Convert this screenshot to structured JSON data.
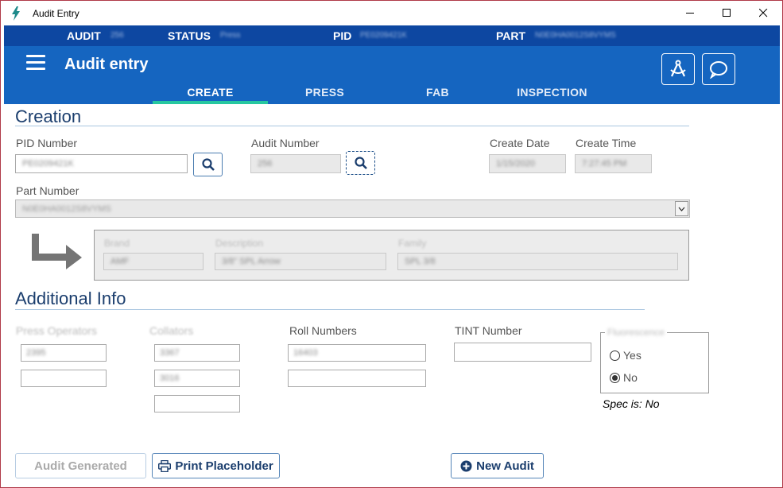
{
  "window": {
    "title": "Audit Entry"
  },
  "infobar": {
    "audit_label": "AUDIT",
    "audit_value": "256",
    "status_label": "STATUS",
    "status_value": "Press",
    "pid_label": "PID",
    "pid_value": "PE0209421K",
    "part_label": "PART",
    "part_value": "N0E0HA0012S8VYMS"
  },
  "header": {
    "title": "Audit entry",
    "tabs": [
      {
        "label": "CREATE",
        "active": true
      },
      {
        "label": "PRESS",
        "active": false
      },
      {
        "label": "FAB",
        "active": false
      },
      {
        "label": "INSPECTION",
        "active": false
      }
    ]
  },
  "creation": {
    "section_title": "Creation",
    "pid_label": "PID Number",
    "pid_value": "PE0209421K",
    "audit_label": "Audit Number",
    "audit_value": "256",
    "create_date_label": "Create Date",
    "create_date_value": "1/15/2020",
    "create_time_label": "Create Time",
    "create_time_value": "7:27:45 PM",
    "part_label": "Part Number",
    "part_value": "N0E0HA0012S8VYMS"
  },
  "details": {
    "brand_label": "Brand",
    "brand_value": "AMF",
    "description_label": "Description",
    "description_value": "3/8\" SPL Arrow",
    "family_label": "Family",
    "family_value": "SPL 3/8"
  },
  "additional": {
    "section_title": "Additional Info",
    "press_operators_label": "Press Operators",
    "press_operators": [
      "2395",
      ""
    ],
    "collators_label": "Collators",
    "collators": [
      "3367",
      "3016",
      ""
    ],
    "roll_numbers_label": "Roll Numbers",
    "roll_numbers": [
      "16403",
      ""
    ],
    "tint_number_label": "TINT Number",
    "tint_number": "",
    "fluorescence_label": "Fluorescence",
    "yes_label": "Yes",
    "no_label": "No",
    "selected": "No",
    "spec_text": "Spec is: No"
  },
  "buttons": {
    "audit_generated": "Audit Generated",
    "print_placeholder": "Print Placeholder",
    "new_audit": "New Audit"
  },
  "colors": {
    "header_blue": "#1565c0",
    "infobar_blue": "#0d47a1",
    "tab_underline": "#26c7a0",
    "title_text": "#1a3d6d"
  }
}
